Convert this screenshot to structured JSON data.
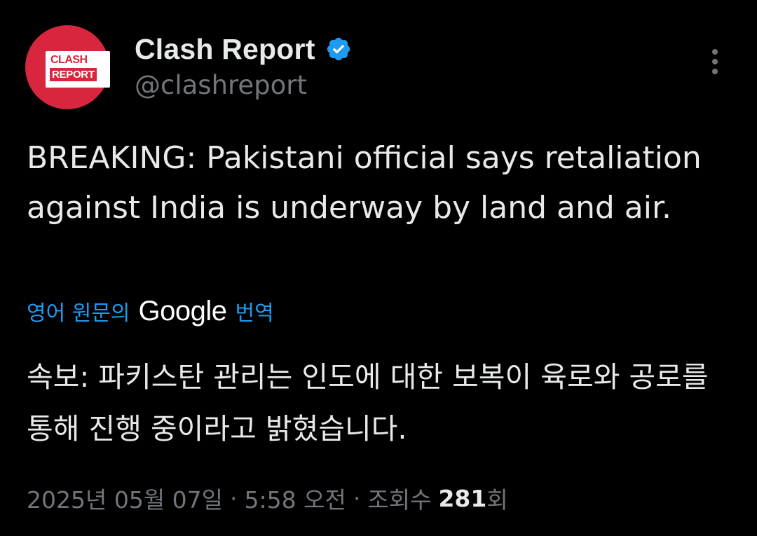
{
  "author": {
    "display_name": "Clash Report",
    "handle": "@clashreport",
    "avatar_text_top": "CLASH",
    "avatar_text_bottom": "REPORT",
    "verified_icon": "verified-badge-icon",
    "avatar_color": "#d7263d",
    "verified_color": "#1d9bf0"
  },
  "menu": {
    "icon": "more-vertical-icon"
  },
  "tweet": {
    "text": "BREAKING: Pakistani official says retaliation against India is underway by land and air."
  },
  "translation": {
    "label_prefix": "영어 원문의",
    "provider": "Google",
    "label_suffix": "번역",
    "translated_text": "속보: 파키스탄 관리는 인도에 대한 보복이 육로와 공로를 통해 진행 중이라고 밝혔습니다.",
    "link_color": "#1d9bf0"
  },
  "meta": {
    "date": "2025년 05월 07일",
    "separator": "·",
    "time": "5:58 오전",
    "views_label": "조회수",
    "views_count": "281",
    "views_suffix": "회"
  },
  "colors": {
    "background": "#000000",
    "text_primary": "#e7e9ea",
    "text_secondary": "#71767b"
  }
}
